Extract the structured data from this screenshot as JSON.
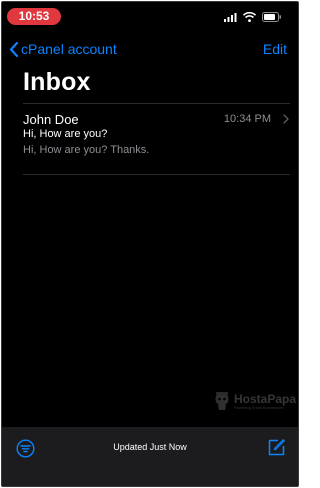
{
  "status_bar": {
    "time": "10:53",
    "time_pill_color": "#e0383e"
  },
  "nav": {
    "back_label": "cPanel account",
    "edit_label": "Edit"
  },
  "page": {
    "title": "Inbox"
  },
  "messages": [
    {
      "sender": "John Doe",
      "time": "10:34 PM",
      "subject": "Hi, How are you?",
      "preview": "Hi, How are you? Thanks."
    }
  ],
  "watermark": {
    "name": "HostaPapa",
    "tagline": "Powering Small Businesses"
  },
  "toolbar": {
    "status": "Updated Just Now",
    "left_icon": "filter-icon",
    "right_icon": "compose-icon"
  },
  "colors": {
    "accent": "#0a84ff",
    "background": "#000000",
    "toolbar": "#1c1c1e",
    "secondary_text": "#8e8e93"
  }
}
